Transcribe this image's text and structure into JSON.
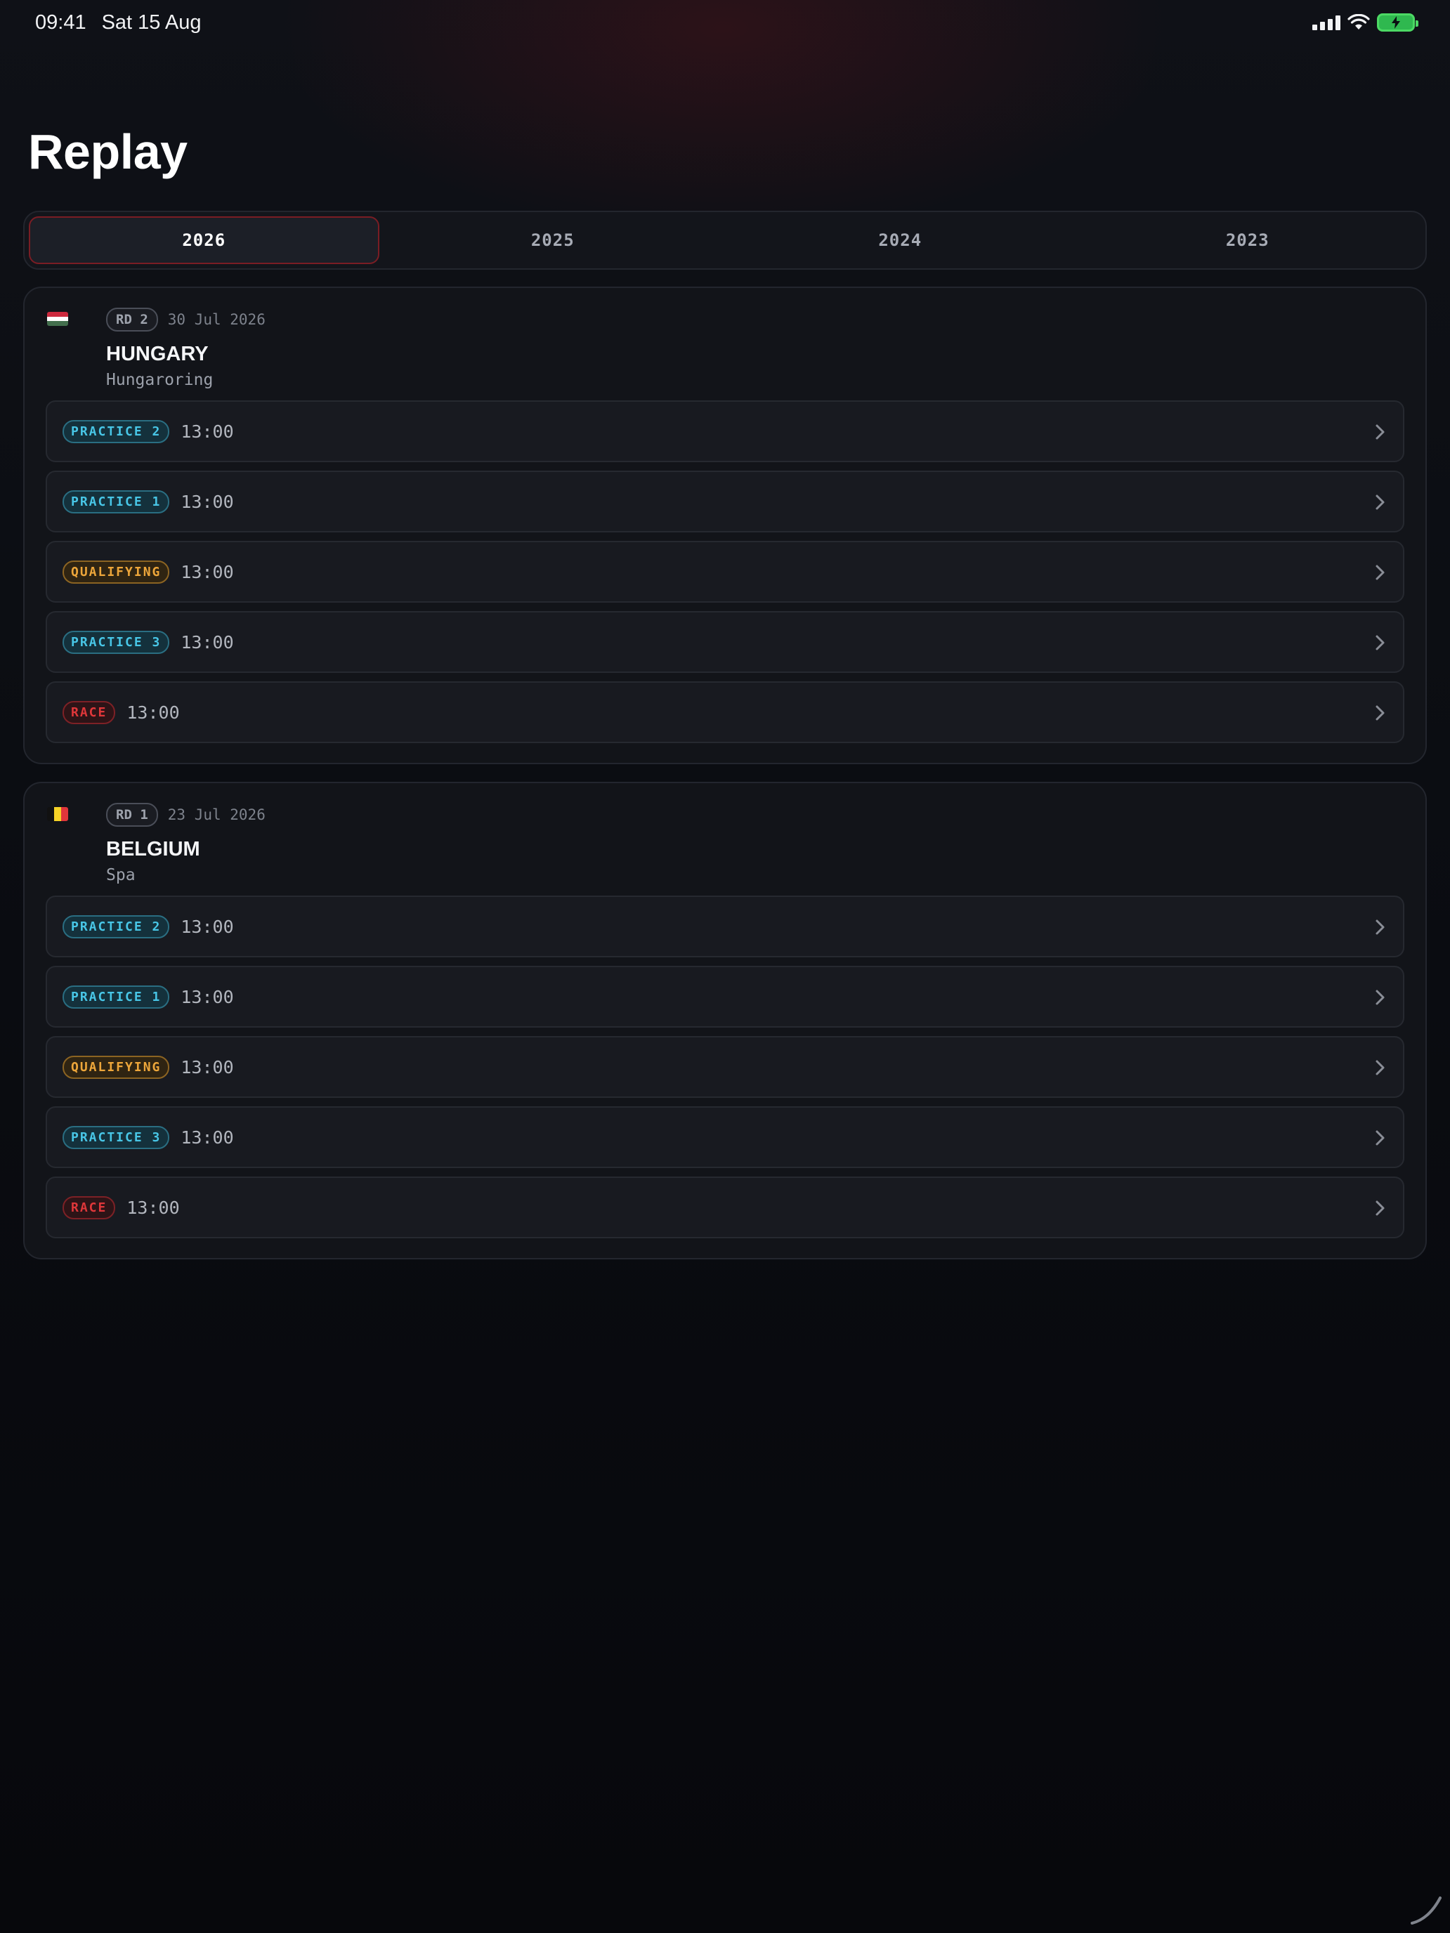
{
  "status_bar": {
    "time": "09:41",
    "date": "Sat 15 Aug"
  },
  "page": {
    "title": "Replay"
  },
  "season_tabs": [
    {
      "label": "2026",
      "selected": true
    },
    {
      "label": "2025",
      "selected": false
    },
    {
      "label": "2024",
      "selected": false
    },
    {
      "label": "2023",
      "selected": false
    }
  ],
  "events": [
    {
      "flag_icon": "flag-hungary-icon",
      "round": "RD 2",
      "date": "30 Jul 2026",
      "country": "HUNGARY",
      "circuit": "Hungaroring",
      "sessions": [
        {
          "type": "practice",
          "label": "PRACTICE 2",
          "time": "13:00"
        },
        {
          "type": "practice",
          "label": "PRACTICE 1",
          "time": "13:00"
        },
        {
          "type": "qualifying",
          "label": "QUALIFYING",
          "time": "13:00"
        },
        {
          "type": "practice",
          "label": "PRACTICE 3",
          "time": "13:00"
        },
        {
          "type": "race",
          "label": "RACE",
          "time": "13:00"
        }
      ]
    },
    {
      "flag_icon": "flag-belgium-icon",
      "round": "RD 1",
      "date": "23 Jul 2026",
      "country": "BELGIUM",
      "circuit": "Spa",
      "sessions": [
        {
          "type": "practice",
          "label": "PRACTICE 2",
          "time": "13:00"
        },
        {
          "type": "practice",
          "label": "PRACTICE 1",
          "time": "13:00"
        },
        {
          "type": "qualifying",
          "label": "QUALIFYING",
          "time": "13:00"
        },
        {
          "type": "practice",
          "label": "PRACTICE 3",
          "time": "13:00"
        },
        {
          "type": "race",
          "label": "RACE",
          "time": "13:00"
        }
      ]
    }
  ],
  "colors": {
    "accent_red": "#7a1d24",
    "practice": "#48c6e6",
    "qualifying": "#eda63a",
    "race": "#e0373a"
  }
}
